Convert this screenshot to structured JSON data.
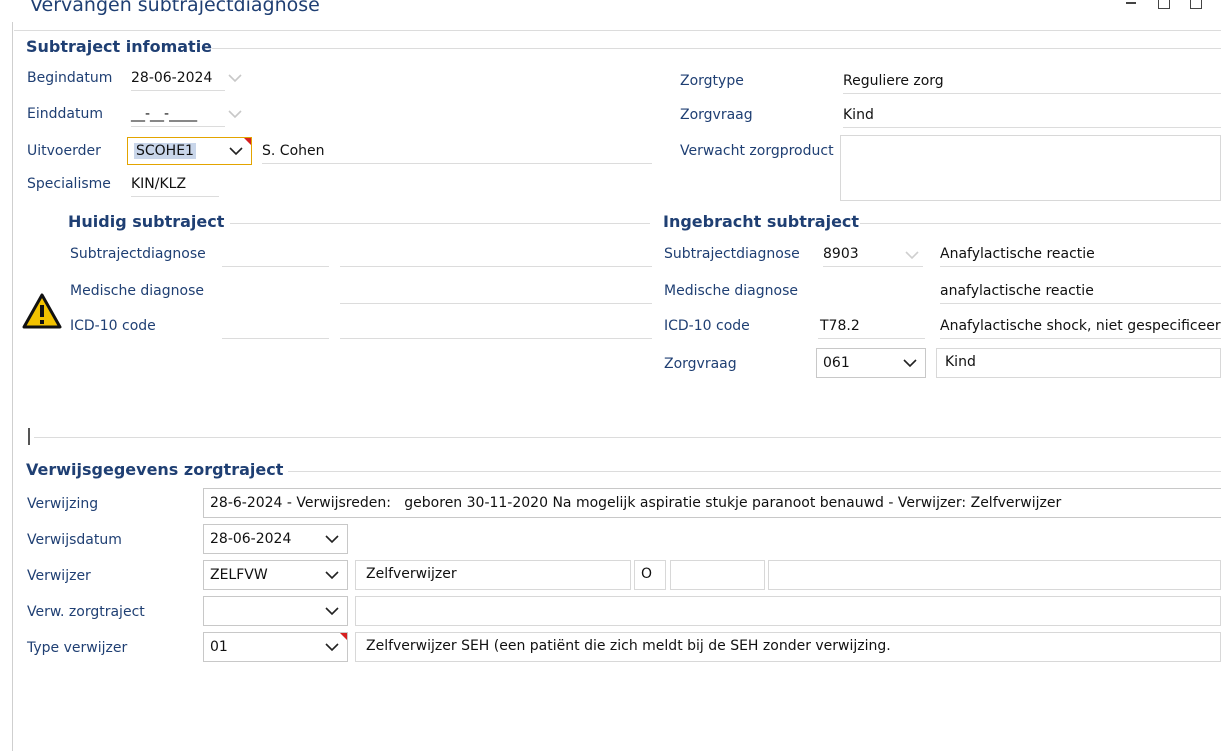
{
  "window": {
    "title": "Vervangen subtrajectdiagnose"
  },
  "colors": {
    "label": "#1f3f73",
    "required_marker": "#d62020",
    "warning": "#f2c200"
  },
  "subtraject": {
    "heading": "Subtraject infomatie",
    "begindatum": {
      "label": "Begindatum",
      "value": "28-06-2024"
    },
    "einddatum": {
      "label": "Einddatum",
      "value": "__-__-____"
    },
    "uitvoerder": {
      "label": "Uitvoerder",
      "code": "SCOHE1",
      "name": "S. Cohen"
    },
    "specialisme": {
      "label": "Specialisme",
      "value": "KIN/KLZ"
    },
    "zorgtype": {
      "label": "Zorgtype",
      "value": "Reguliere zorg"
    },
    "zorgvraag": {
      "label": "Zorgvraag",
      "value": "Kind"
    },
    "verwacht_zorgproduct": {
      "label": "Verwacht zorgproduct",
      "value": ""
    }
  },
  "huidig": {
    "heading": "Huidig subtraject",
    "warning_icon": "warning-triangle-icon",
    "subtrajectdiagnose": {
      "label": "Subtrajectdiagnose"
    },
    "medische_diagnose": {
      "label": "Medische diagnose"
    },
    "icd10": {
      "label": "ICD-10 code"
    }
  },
  "ingebracht": {
    "heading": "Ingebracht subtraject",
    "subtrajectdiagnose": {
      "label": "Subtrajectdiagnose",
      "code": "8903",
      "description": "Anafylactische reactie"
    },
    "medische_diagnose": {
      "label": "Medische diagnose",
      "description": "anafylactische reactie"
    },
    "icd10": {
      "label": "ICD-10 code",
      "code": "T78.2",
      "description": "Anafylactische shock, niet gespecificeerd"
    },
    "zorgvraag": {
      "label": "Zorgvraag",
      "code": "061",
      "description": "Kind"
    }
  },
  "verwijs": {
    "heading": "Verwijsgegevens zorgtraject",
    "verwijzing": {
      "label": "Verwijzing",
      "value": "28-6-2024 - Verwijsreden:   geboren 30-11-2020 Na mogelijk aspiratie stukje paranoot benauwd - Verwijzer: Zelfverwijzer"
    },
    "verwijsdatum": {
      "label": "Verwijsdatum",
      "value": "28-06-2024"
    },
    "verwijzer": {
      "label": "Verwijzer",
      "code": "ZELFVW",
      "name": "Zelfverwijzer",
      "extra": "O"
    },
    "verw_zorgtraject": {
      "label": "Verw. zorgtraject",
      "value": ""
    },
    "type_verwijzer": {
      "label": "Type verwijzer",
      "code": "01",
      "description": "Zelfverwijzer SEH (een patiënt die zich meldt bij de SEH zonder verwijzing."
    }
  }
}
